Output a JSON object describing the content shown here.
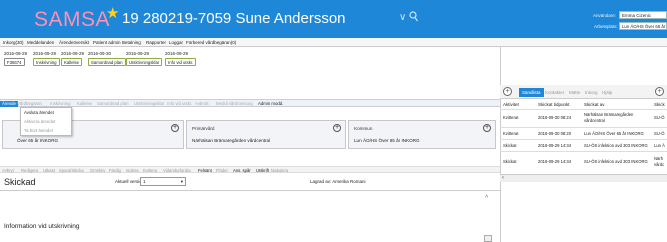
{
  "header": {
    "logo": "SAMSA",
    "patient": "19 280219-7059 Sune Andersson",
    "user_label": "Användare:",
    "user_value": "Emma Cizenic",
    "workplace_label": "Arbetsplats:",
    "workplace_value": "Lun ÄO/HS Över 65 år INKORG",
    "colors": {
      "header_bg": "#1f87d8",
      "logo": "#ff8fb3",
      "star": "#ffd21a"
    }
  },
  "menu": [
    "Inkorg(30)",
    "Meddelanden",
    "Ärendeöversikt",
    "Patient admin",
    "Betalning",
    "Rapporter",
    "Loggar",
    "Förbered vårdbegäran(0)"
  ],
  "dates": {
    "row1": [
      "2016-09-29",
      "2016-09-29",
      "2016-09-29",
      "2016-09-30",
      "2016-09-29",
      "2016-09-29"
    ],
    "row2": [
      "F35674",
      "Inskrivning",
      "Kallelse",
      "Samordnad plan",
      "Utskrivningsklar",
      "Info vid utskr."
    ]
  },
  "sections": [
    "Ärende",
    "Vårdbegäran",
    "Inskrivning",
    "Kallelse",
    "Samordnad plan",
    "Utskrivningsklar",
    "Info vid utskr.",
    "Avbrott",
    "Meddi vård/omsorg",
    "Admin modd."
  ],
  "dropdown": [
    "Avsluta ärendet",
    "Aktivera ärendet",
    "Ta bort ärendet"
  ],
  "cards": [
    {
      "title": "",
      "value": "Över 65 år INKORG"
    },
    {
      "title": "Primärvård",
      "value": "Närhälsan Brämaregården vårdcentral"
    },
    {
      "title": "Kommun",
      "value": "Lun ÄO/HS Över 65 år INKORG"
    }
  ],
  "actions": [
    "Avbryt",
    "Redigera",
    "Utkast",
    "Spara/Skicka",
    "Omskriv",
    "Färdig",
    "Isolera",
    "Kvittera",
    "Vidarebefordra",
    "Felsänt",
    "Flödet",
    "Ans. spår",
    "Utskrift",
    "Makulera"
  ],
  "form": {
    "title": "Skickad",
    "version_label": "Aktuell version:",
    "version_value": "1",
    "saved_by": "Lagrad av: Amerika Romani",
    "subheading": "Information vid utskrivning"
  },
  "right_panel": {
    "tabs": [
      "Sändlista",
      "Kontakter",
      "Mätte",
      "Inkorg",
      "Hjälp"
    ],
    "columns": [
      "Aktivitet",
      "Skickat tidpunkt",
      "Skickat av",
      "Skick"
    ],
    "rows": [
      [
        "Kvitterat",
        "2016-09-30 08:24",
        "Närhälsan Brämaregården vårdcentral",
        "SU-Ö"
      ],
      [
        "Kvitterat",
        "2016-09-30 08:20",
        "Lun ÄO/HS Över 65 år INKORG",
        "SU-Ö"
      ],
      [
        "Skickat",
        "2016-09-29 14:34",
        "SU-ÖS infektion avd 303 INKORG",
        "Lun Ä"
      ],
      [
        "Skickat",
        "2016-09-29 14:34",
        "SU-ÖS infektion avd 303 INKORG",
        "Närh vårdc"
      ]
    ]
  }
}
